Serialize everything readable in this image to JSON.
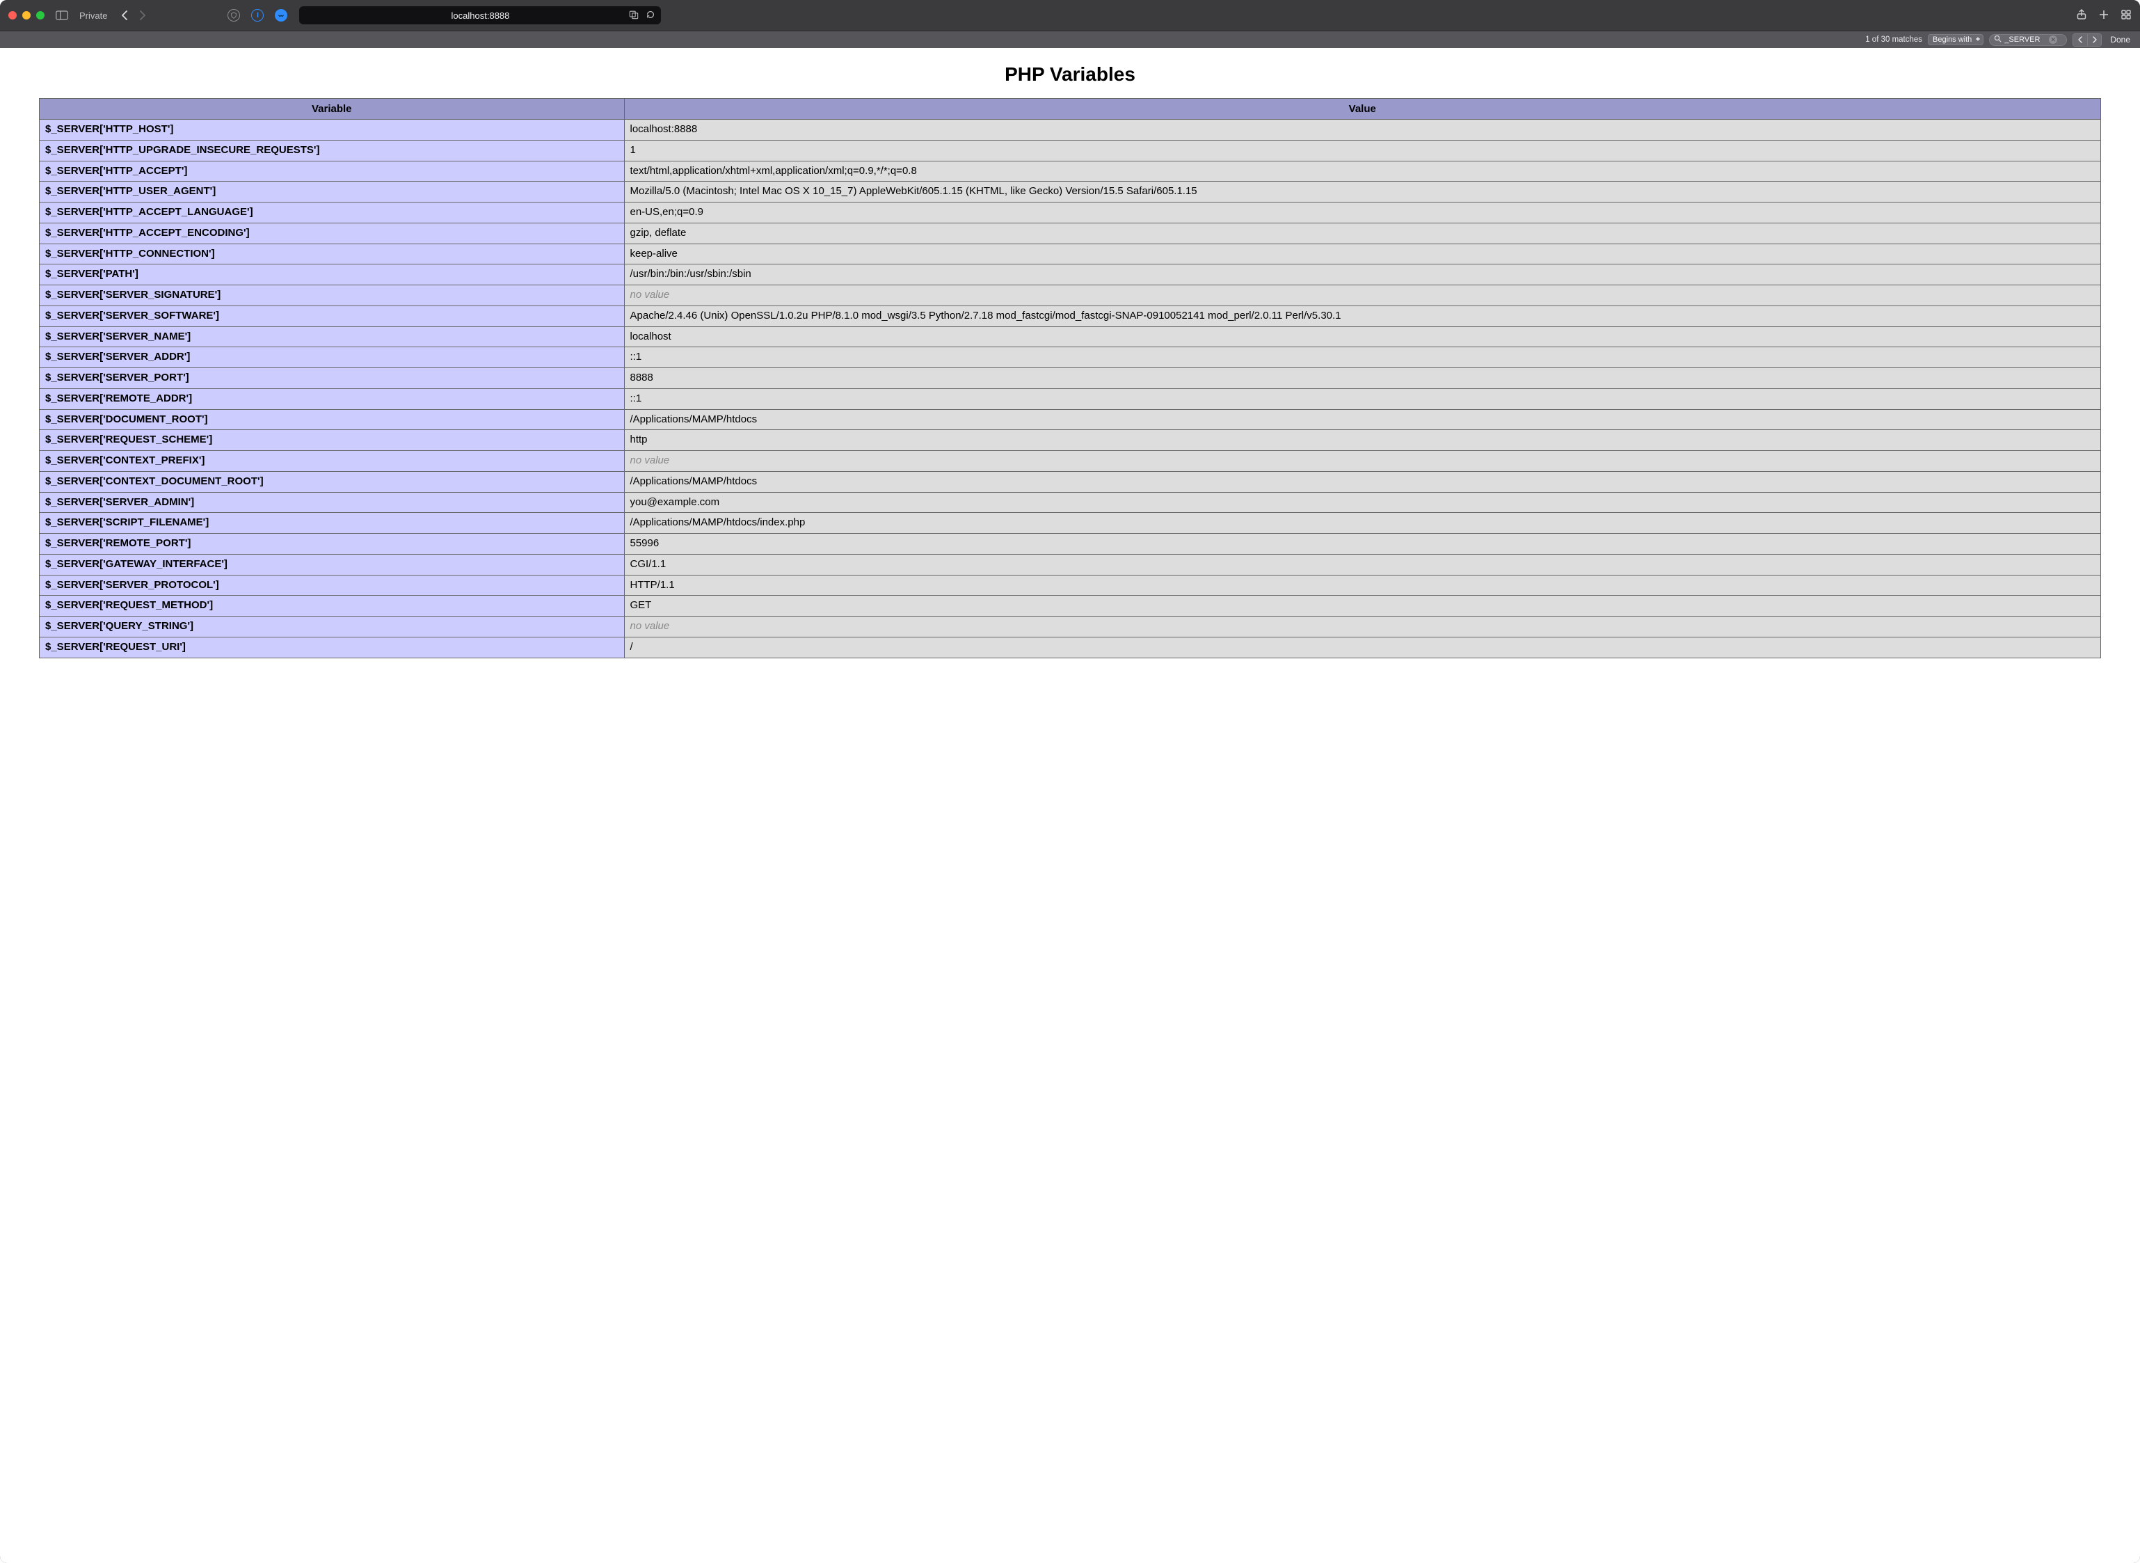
{
  "browser": {
    "private_label": "Private",
    "address": "localhost:8888"
  },
  "findbar": {
    "matches_text": "1 of 30 matches",
    "mode_label": "Begins with",
    "search_value": "_SERVER",
    "done_label": "Done"
  },
  "page": {
    "title": "PHP Variables",
    "columns": {
      "variable": "Variable",
      "value": "Value"
    },
    "no_value_text": "no value",
    "rows": [
      {
        "k": "$_SERVER['HTTP_HOST']",
        "v": "localhost:8888"
      },
      {
        "k": "$_SERVER['HTTP_UPGRADE_INSECURE_REQUESTS']",
        "v": "1"
      },
      {
        "k": "$_SERVER['HTTP_ACCEPT']",
        "v": "text/html,application/xhtml+xml,application/xml;q=0.9,*/*;q=0.8"
      },
      {
        "k": "$_SERVER['HTTP_USER_AGENT']",
        "v": "Mozilla/5.0 (Macintosh; Intel Mac OS X 10_15_7) AppleWebKit/605.1.15 (KHTML, like Gecko) Version/15.5 Safari/605.1.15"
      },
      {
        "k": "$_SERVER['HTTP_ACCEPT_LANGUAGE']",
        "v": "en-US,en;q=0.9"
      },
      {
        "k": "$_SERVER['HTTP_ACCEPT_ENCODING']",
        "v": "gzip, deflate"
      },
      {
        "k": "$_SERVER['HTTP_CONNECTION']",
        "v": "keep-alive"
      },
      {
        "k": "$_SERVER['PATH']",
        "v": "/usr/bin:/bin:/usr/sbin:/sbin"
      },
      {
        "k": "$_SERVER['SERVER_SIGNATURE']",
        "v": null
      },
      {
        "k": "$_SERVER['SERVER_SOFTWARE']",
        "v": "Apache/2.4.46 (Unix) OpenSSL/1.0.2u PHP/8.1.0 mod_wsgi/3.5 Python/2.7.18 mod_fastcgi/mod_fastcgi-SNAP-0910052141 mod_perl/2.0.11 Perl/v5.30.1"
      },
      {
        "k": "$_SERVER['SERVER_NAME']",
        "v": "localhost"
      },
      {
        "k": "$_SERVER['SERVER_ADDR']",
        "v": "::1"
      },
      {
        "k": "$_SERVER['SERVER_PORT']",
        "v": "8888"
      },
      {
        "k": "$_SERVER['REMOTE_ADDR']",
        "v": "::1"
      },
      {
        "k": "$_SERVER['DOCUMENT_ROOT']",
        "v": "/Applications/MAMP/htdocs"
      },
      {
        "k": "$_SERVER['REQUEST_SCHEME']",
        "v": "http"
      },
      {
        "k": "$_SERVER['CONTEXT_PREFIX']",
        "v": null
      },
      {
        "k": "$_SERVER['CONTEXT_DOCUMENT_ROOT']",
        "v": "/Applications/MAMP/htdocs"
      },
      {
        "k": "$_SERVER['SERVER_ADMIN']",
        "v": "you@example.com"
      },
      {
        "k": "$_SERVER['SCRIPT_FILENAME']",
        "v": "/Applications/MAMP/htdocs/index.php"
      },
      {
        "k": "$_SERVER['REMOTE_PORT']",
        "v": "55996"
      },
      {
        "k": "$_SERVER['GATEWAY_INTERFACE']",
        "v": "CGI/1.1"
      },
      {
        "k": "$_SERVER['SERVER_PROTOCOL']",
        "v": "HTTP/1.1"
      },
      {
        "k": "$_SERVER['REQUEST_METHOD']",
        "v": "GET"
      },
      {
        "k": "$_SERVER['QUERY_STRING']",
        "v": null
      },
      {
        "k": "$_SERVER['REQUEST_URI']",
        "v": "/"
      }
    ]
  }
}
